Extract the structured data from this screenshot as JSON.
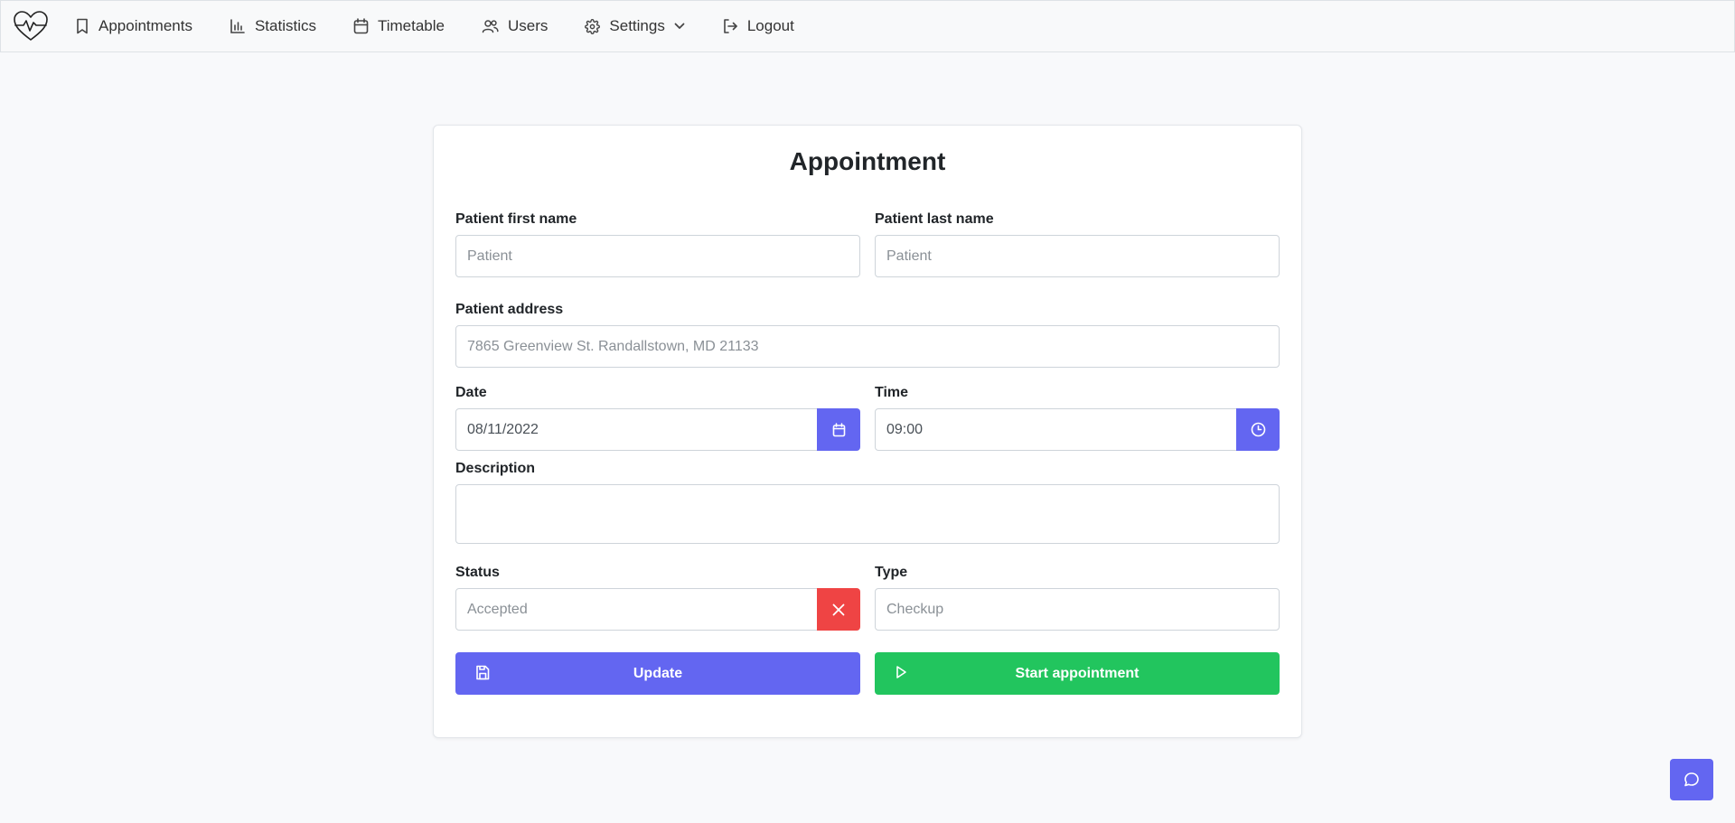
{
  "nav": {
    "logo_icon": "heart-pulse-icon",
    "items": [
      {
        "label": "Appointments",
        "icon": "bookmark-icon"
      },
      {
        "label": "Statistics",
        "icon": "bar-chart-icon"
      },
      {
        "label": "Timetable",
        "icon": "calendar-icon"
      },
      {
        "label": "Users",
        "icon": "users-icon"
      },
      {
        "label": "Settings",
        "icon": "gear-icon"
      },
      {
        "label": "Logout",
        "icon": "logout-icon"
      }
    ]
  },
  "form": {
    "title": "Appointment",
    "first_name": {
      "label": "Patient first name",
      "placeholder": "Patient",
      "value": ""
    },
    "last_name": {
      "label": "Patient last name",
      "placeholder": "Patient",
      "value": ""
    },
    "address": {
      "label": "Patient address",
      "placeholder": "7865 Greenview St. Randallstown, MD 21133",
      "value": ""
    },
    "date": {
      "label": "Date",
      "value": "08/11/2022"
    },
    "time": {
      "label": "Time",
      "value": "09:00"
    },
    "description": {
      "label": "Description",
      "value": ""
    },
    "status": {
      "label": "Status",
      "placeholder": "Accepted",
      "value": ""
    },
    "type": {
      "label": "Type",
      "placeholder": "Checkup",
      "value": ""
    },
    "update_label": "Update",
    "start_label": "Start appointment"
  },
  "colors": {
    "primary": "#6366f1",
    "danger": "#ef4444",
    "success": "#22c55e"
  }
}
